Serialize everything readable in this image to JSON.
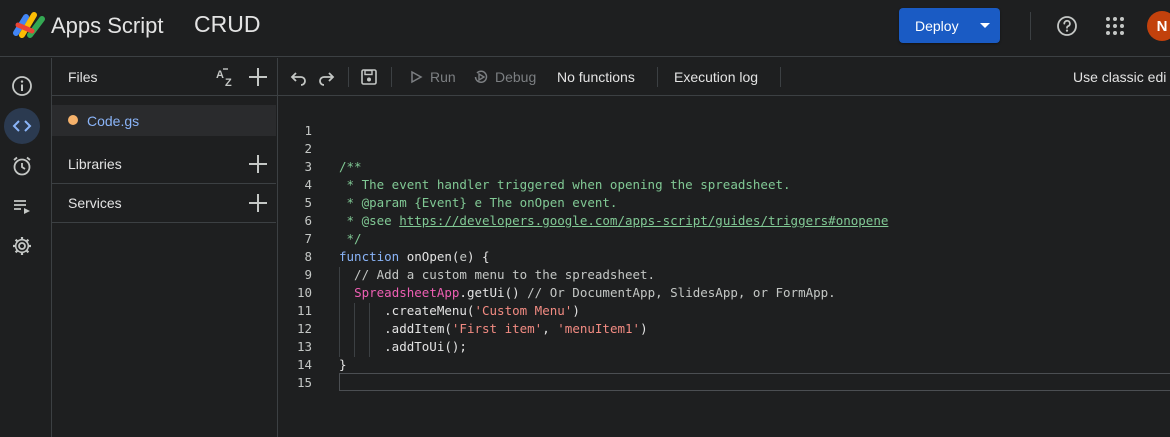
{
  "header": {
    "app_name": "Apps Script",
    "project_name": "CRUD",
    "deploy_label": "Deploy",
    "avatar_initial": "N"
  },
  "rail": {
    "icons": [
      "info-icon",
      "code-icon",
      "alarm-clock-icon",
      "executions-icon",
      "settings-icon"
    ],
    "active": "code-icon"
  },
  "files_panel": {
    "title": "Files",
    "files": [
      {
        "name": "Code.gs",
        "dot_color": "#f6b26b"
      }
    ],
    "sections": [
      "Libraries",
      "Services"
    ]
  },
  "toolbar": {
    "run_label": "Run",
    "debug_label": "Debug",
    "function_select": "No functions",
    "execution_log_label": "Execution log",
    "classic_editor_label": "Use classic edi"
  },
  "editor": {
    "line_numbers": [
      "1",
      "2",
      "3",
      "4",
      "5",
      "6",
      "7",
      "8",
      "9",
      "10",
      "11",
      "12",
      "13",
      "14",
      "15"
    ],
    "lines": [
      "",
      "",
      "/**",
      " * The event handler triggered when opening the spreadsheet.",
      " * @param {Event} e The onOpen event.",
      " * @see https://developers.google.com/apps-script/guides/triggers#onopene",
      " */",
      "function onOpen(e) {",
      "  // Add a custom menu to the spreadsheet.",
      "  SpreadsheetApp.getUi() // Or DocumentApp, SlidesApp, or FormApp.",
      "      .createMenu('Custom Menu')",
      "      .addItem('First item', 'menuItem1')",
      "      .addToUi();",
      "}",
      ""
    ]
  },
  "colors": {
    "accent": "#1a5bc4",
    "comment": "#81c995",
    "keyword": "#8ab4f8",
    "class": "#ee5fb3",
    "string": "#f28b82"
  }
}
